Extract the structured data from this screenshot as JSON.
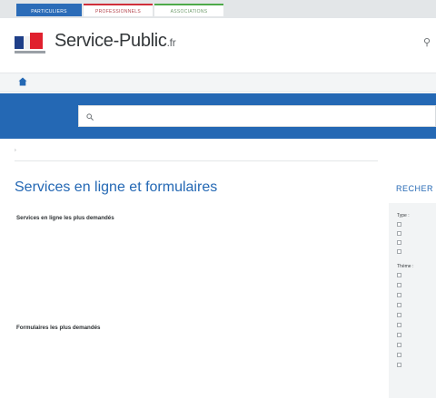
{
  "top_tabs": [
    {
      "label": "Particuliers"
    },
    {
      "label": "Professionnels"
    },
    {
      "label": "Associations"
    },
    {
      "label": ""
    }
  ],
  "brand": {
    "name": "Service-Public",
    "tld": ".fr",
    "tagline": ""
  },
  "nav": {
    "items": [
      {
        "label": ""
      },
      {
        "label": ""
      },
      {
        "label": ""
      },
      {
        "label": ""
      },
      {
        "label": ""
      },
      {
        "label": ""
      },
      {
        "label": ""
      },
      {
        "label": ""
      },
      {
        "label": ""
      }
    ]
  },
  "search": {
    "placeholder": ""
  },
  "breadcrumb": {
    "home": "",
    "current": ""
  },
  "page": {
    "title": "Services en ligne et formulaires"
  },
  "services": {
    "heading": "Services en ligne les plus demandés",
    "items": [
      "",
      "",
      "",
      "",
      "",
      ""
    ],
    "see_all": ""
  },
  "forms": {
    "heading": "Formulaires les plus demandés",
    "items": [
      "",
      "",
      "",
      "",
      "",
      ""
    ]
  },
  "sidebar": {
    "title": "RECHER",
    "type_heading": "Type :",
    "type_options": [
      "",
      "",
      "",
      ""
    ],
    "theme_heading": "Thème :",
    "theme_options": [
      "",
      "",
      "",
      "",
      "",
      "",
      "",
      "",
      "",
      ""
    ]
  },
  "colors": {
    "accent_blue": "#2468b4",
    "tab_active": "#2b6cb8",
    "pro_red": "#d02e3a",
    "assoc_green": "#4eaa4a",
    "flag_blue": "#1f3f88",
    "flag_red": "#e0202e"
  },
  "icons": {
    "home": "home-icon",
    "search": "search-icon",
    "corner": "user-icon"
  }
}
